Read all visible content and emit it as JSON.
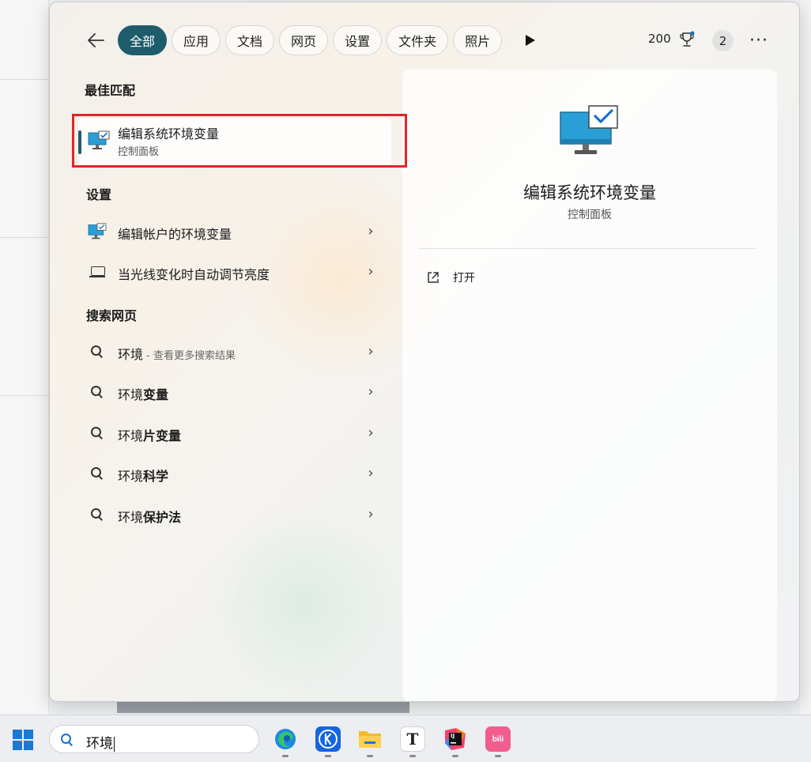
{
  "filters": {
    "items": [
      {
        "label": "全部",
        "active": true
      },
      {
        "label": "应用",
        "active": false
      },
      {
        "label": "文档",
        "active": false
      },
      {
        "label": "网页",
        "active": false
      },
      {
        "label": "设置",
        "active": false
      },
      {
        "label": "文件夹",
        "active": false
      },
      {
        "label": "照片",
        "active": false
      }
    ]
  },
  "header": {
    "points": "200",
    "notification_count": "2",
    "more_label": "···"
  },
  "best_match": {
    "section_title": "最佳匹配",
    "title": "编辑系统环境变量",
    "subtitle": "控制面板"
  },
  "settings": {
    "section_title": "设置",
    "items": [
      {
        "label": "编辑帐户的环境变量",
        "icon": "monitor-icon"
      },
      {
        "label": "当光线变化时自动调节亮度",
        "icon": "laptop-icon"
      }
    ]
  },
  "web_search": {
    "section_title": "搜索网页",
    "items": [
      {
        "query": "环境",
        "suffix": "",
        "hint": " - 查看更多搜索结果"
      },
      {
        "query": "环境",
        "suffix": "变量",
        "hint": ""
      },
      {
        "query": "环境",
        "suffix": "片变量",
        "hint": ""
      },
      {
        "query": "环境",
        "suffix": "科学",
        "hint": ""
      },
      {
        "query": "环境",
        "suffix": "保护法",
        "hint": ""
      }
    ]
  },
  "detail": {
    "title": "编辑系统环境变量",
    "subtitle": "控制面板",
    "open_label": "打开"
  },
  "taskbar": {
    "search_text": "环境",
    "apps": [
      "edge-icon",
      "kuaiwen-icon",
      "file-explorer-icon",
      "typora-icon",
      "intellij-icon",
      "bilibili-icon"
    ],
    "typora_glyph": "T",
    "intellij_glyph": "IJ",
    "bilibili_glyph": "bili"
  },
  "colors": {
    "accent": "#1f5c6b",
    "highlight_box": "#e3242b",
    "search_blue": "#1a6fd0"
  }
}
